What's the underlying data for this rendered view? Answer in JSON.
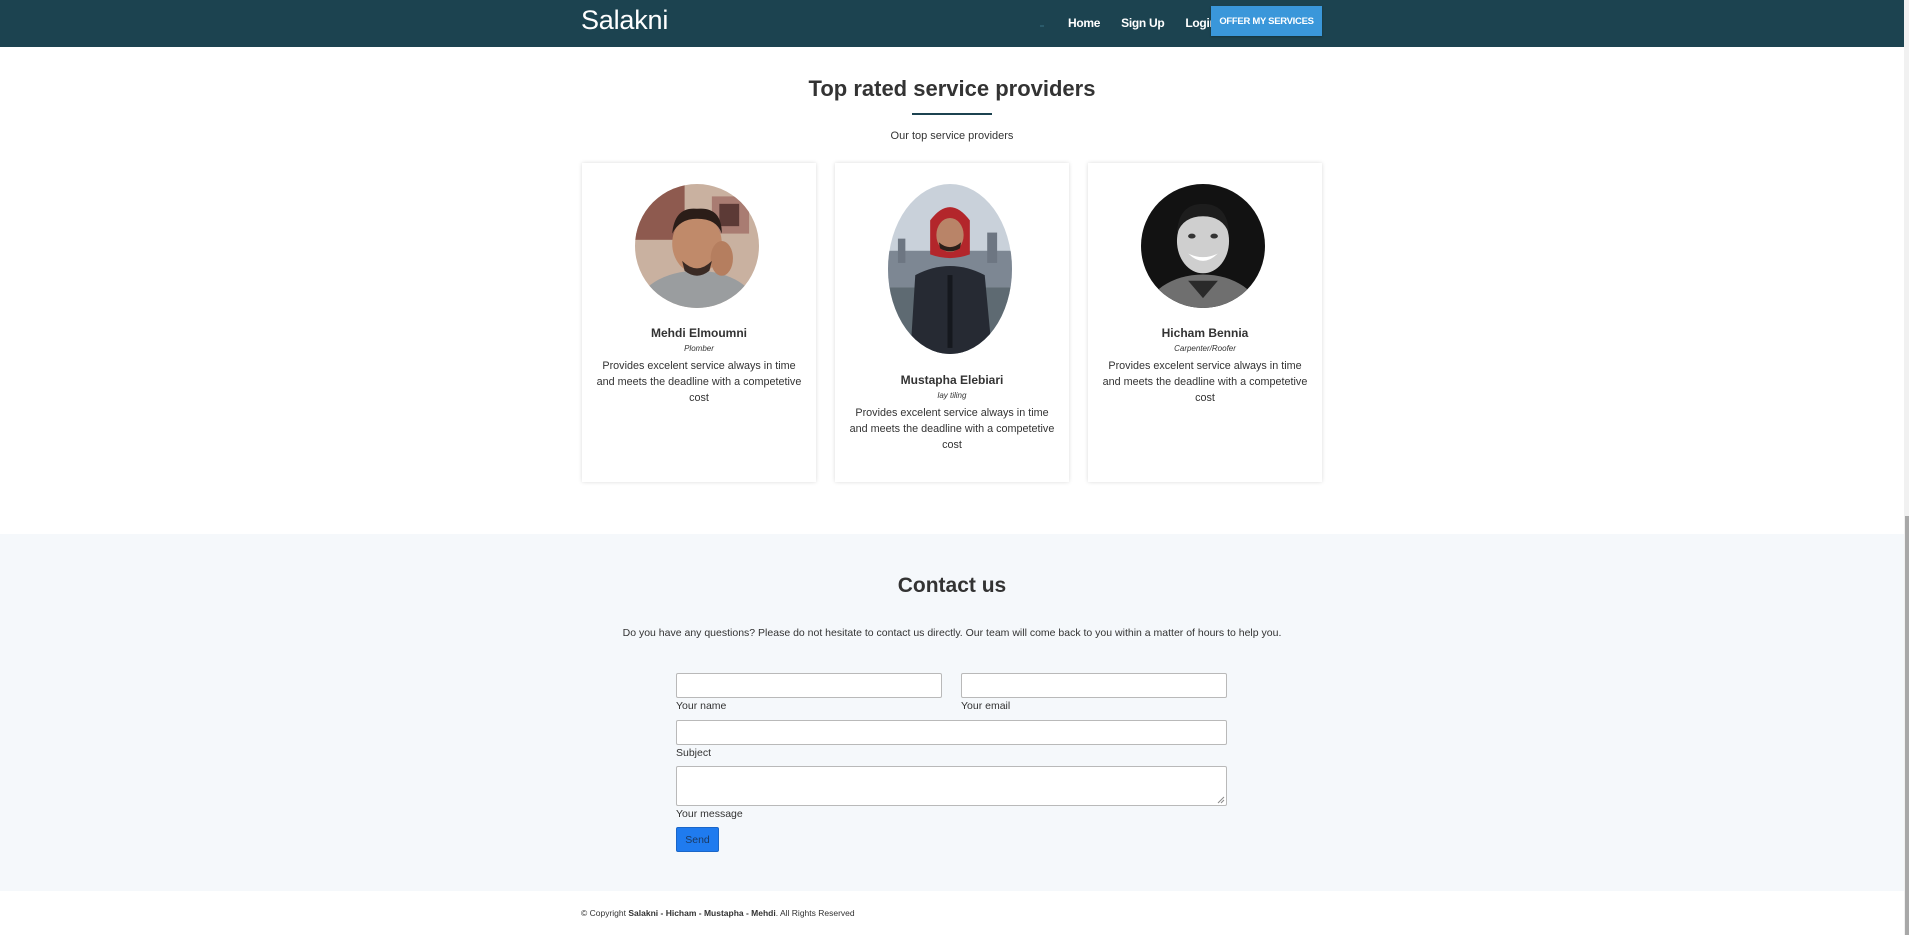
{
  "navbar": {
    "brand": "Salakni",
    "links": [
      "Home",
      "Sign Up",
      "Login"
    ],
    "cta": "OFFER MY SERVICES",
    "colors": {
      "background": "#1c4350",
      "cta": "#3a97da"
    }
  },
  "providers_section": {
    "title": "Top rated service providers",
    "subtitle": "Our top service providers",
    "providers": [
      {
        "name": "Mehdi Elmoumni",
        "role": "Plomber",
        "description": "Provides excelent service always in time and meets the deadline with a competetive cost"
      },
      {
        "name": "Mustapha Elebiari",
        "role": "lay tiling",
        "description": "Provides excelent service always in time and meets the deadline with a competetive cost"
      },
      {
        "name": "Hicham Bennia",
        "role": "Carpenter/Roofer",
        "description": "Provides excelent service always in time and meets the deadline with a competetive cost"
      }
    ]
  },
  "contact": {
    "title": "Contact us",
    "description": "Do you have any questions? Please do not hesitate to contact us directly. Our team will come back to you within a matter of hours to help you.",
    "fields": {
      "name_label": "Your name",
      "email_label": "Your email",
      "subject_label": "Subject",
      "message_label": "Your message",
      "name_value": "",
      "email_value": "",
      "subject_value": "",
      "message_value": ""
    },
    "send_label": "Send",
    "colors": {
      "background": "#f5f8fb",
      "send": "#1f7bef"
    }
  },
  "footer": {
    "prefix": "© Copyright ",
    "authors": "Salakni - Hicham - Mustapha - Mehdi",
    "suffix": ". All Rights Reserved"
  }
}
